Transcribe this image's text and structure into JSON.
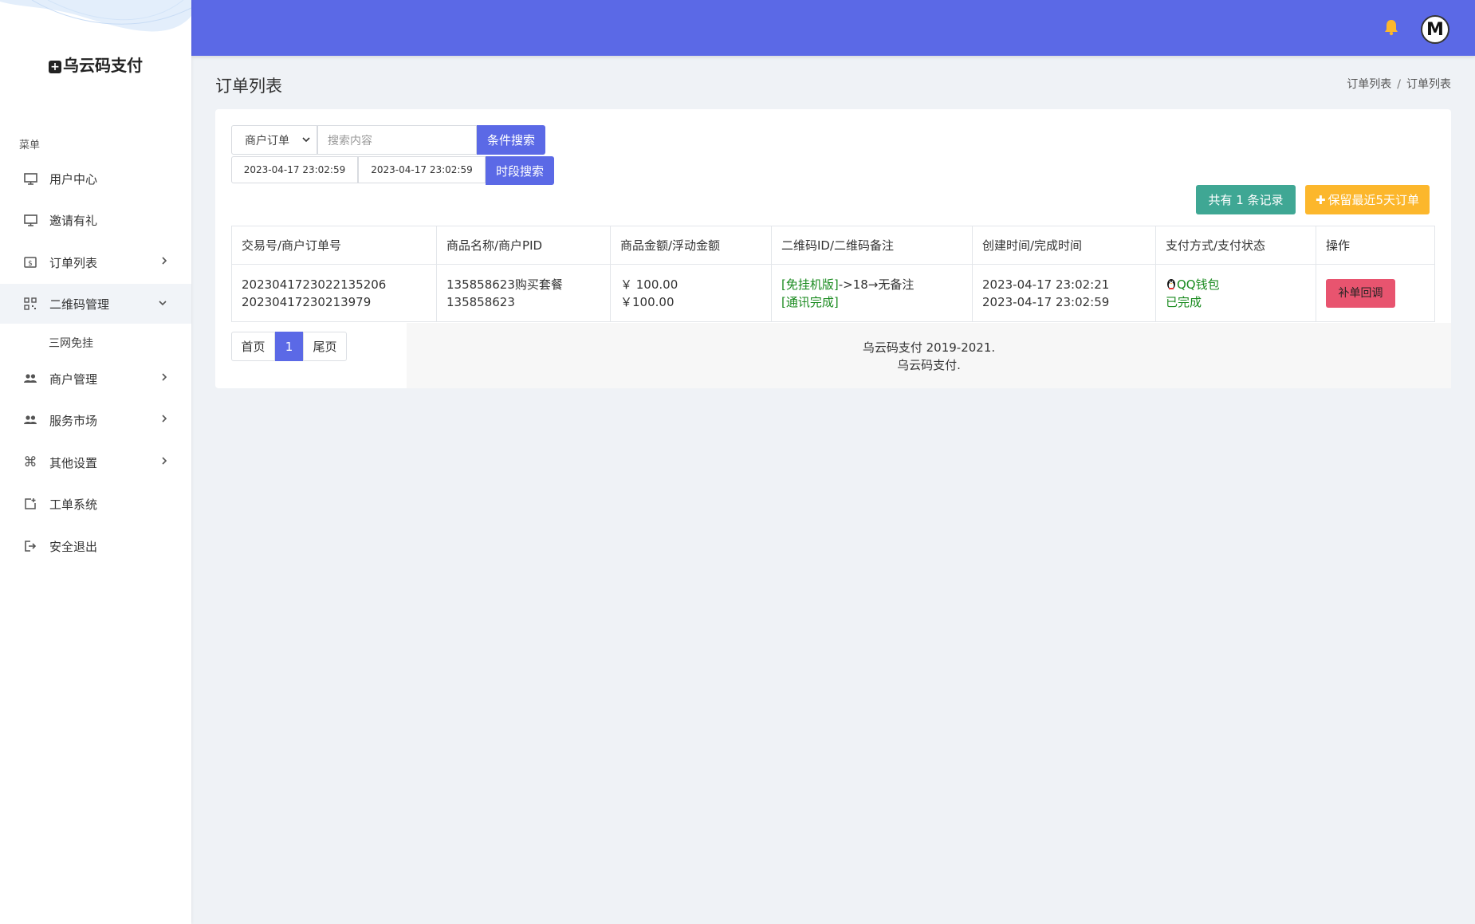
{
  "brand": {
    "name": "乌云码支付"
  },
  "sidebar": {
    "menu_title": "菜单",
    "items": [
      {
        "label": "用户中心"
      },
      {
        "label": "邀请有礼"
      },
      {
        "label": "订单列表"
      },
      {
        "label": "二维码管理"
      },
      {
        "label": "商户管理"
      },
      {
        "label": "服务市场"
      },
      {
        "label": "其他设置"
      },
      {
        "label": "工单系统"
      },
      {
        "label": "安全退出"
      }
    ],
    "sub_item": "三网免挂"
  },
  "page": {
    "title": "订单列表",
    "breadcrumb": [
      "订单列表",
      "订单列表"
    ]
  },
  "filters": {
    "type_selected": "商户订单",
    "search_placeholder": "搜索内容",
    "search_button": "条件搜索",
    "date_start": "2023-04-17 23:02:59",
    "date_end": "2023-04-17 23:02:59",
    "time_button": "时段搜索"
  },
  "actions": {
    "count_button": "共有 1 条记录",
    "keep_button": "保留最近5天订单"
  },
  "table": {
    "headers": [
      "交易号/商户订单号",
      "商品名称/商户PID",
      "商品金额/浮动金额",
      "二维码ID/二维码备注",
      "创建时间/完成时间",
      "支付方式/支付状态",
      "操作"
    ],
    "rows": [
      {
        "trade_no": "2023041723022135206",
        "order_no": "20230417230213979",
        "product": "135858623购买套餐",
        "pid": "135858623",
        "amount": "￥ 100.00",
        "float_amount": "￥100.00",
        "qr_mode": "[免挂机版]",
        "qr_note": "->18→无备注",
        "qr_status": "[通讯完成]",
        "created": "2023-04-17 23:02:21",
        "completed": "2023-04-17 23:02:59",
        "pay_method": "QQ钱包",
        "pay_status": "已完成",
        "action": "补单回调"
      }
    ]
  },
  "pager": {
    "first": "首页",
    "current": "1",
    "last": "尾页"
  },
  "footer": {
    "line1": "乌云码支付 2019-2021.",
    "line2": "乌云码支付."
  },
  "colors": {
    "primary": "#5b69e6",
    "success": "#3fa794",
    "warning": "#fcb72c",
    "danger": "#e8546f",
    "green_text": "#198a1e"
  }
}
